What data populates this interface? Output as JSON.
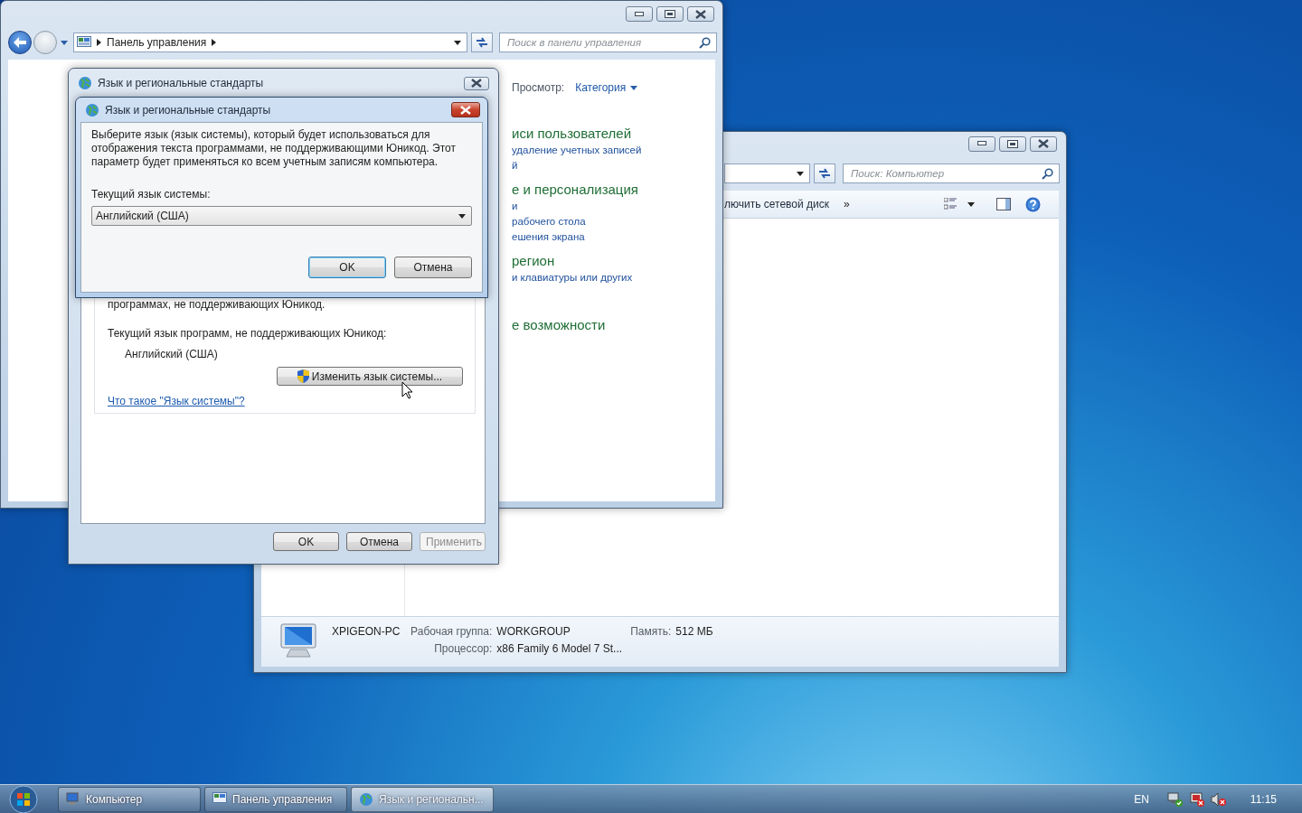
{
  "computer_window": {
    "search": {
      "placeholder": "Поиск: Компьютер"
    },
    "toolbar": {
      "command": "лючить сетевой диск",
      "more": "»"
    },
    "details": {
      "computer_name": "XPIGEON-PC",
      "fields": [
        {
          "label": "Рабочая группа:",
          "value": "WORKGROUP"
        },
        {
          "label": "Память:",
          "value": "512 МБ"
        },
        {
          "label": "Процессор:",
          "value": "x86 Family 6 Model 7 St..."
        }
      ]
    }
  },
  "control_panel_window": {
    "address": {
      "location": "Панель управления"
    },
    "search": {
      "placeholder": "Поиск в панели управления"
    },
    "view_label": "Просмотр:",
    "view_value": "Категория",
    "categories": [
      {
        "heading": "иси пользователей",
        "links": [
          "удаление учетных записей",
          "й"
        ]
      },
      {
        "heading": "е и персонализация",
        "links": [
          "и",
          "рабочего стола",
          "ешения экрана"
        ]
      },
      {
        "heading": "регион",
        "links": [
          "и клавиатуры или других"
        ]
      },
      {
        "heading": "е возможности"
      }
    ]
  },
  "region_dialog": {
    "title": "Язык и региональные стандарты",
    "group": {
      "text": "программах, не поддерживающих Юникод.",
      "current_label": "Текущий язык программ, не поддерживающих Юникод:",
      "current_value": "Английский (США)",
      "change_button": "Изменить язык системы...",
      "help_link": "Что такое \"Язык системы\"?"
    },
    "buttons": [
      {
        "label": "OK",
        "default": false,
        "disabled": false
      },
      {
        "label": "Отмена",
        "default": false,
        "disabled": false
      },
      {
        "label": "Применить",
        "default": false,
        "disabled": true
      }
    ]
  },
  "system_locale_dialog": {
    "title": "Язык и региональные стандарты",
    "message": "Выберите язык (язык системы), который будет использоваться для отображения текста программами, не поддерживающими Юникод. Этот параметр будет применяться ко всем учетным записям компьютера.",
    "label": "Текущий язык системы:",
    "combo": {
      "value": "Английский (США)"
    },
    "buttons": [
      {
        "label": "OK",
        "default": true,
        "disabled": false
      },
      {
        "label": "Отмена",
        "default": false,
        "disabled": false
      }
    ]
  },
  "taskbar": {
    "buttons": [
      {
        "label": "Компьютер",
        "kind": "computer",
        "selected": false
      },
      {
        "label": "Панель управления",
        "kind": "control-panel",
        "selected": false
      },
      {
        "label": "Язык и региональн...",
        "kind": "globe",
        "selected": true
      }
    ],
    "language": "EN",
    "clock": "11:15"
  }
}
